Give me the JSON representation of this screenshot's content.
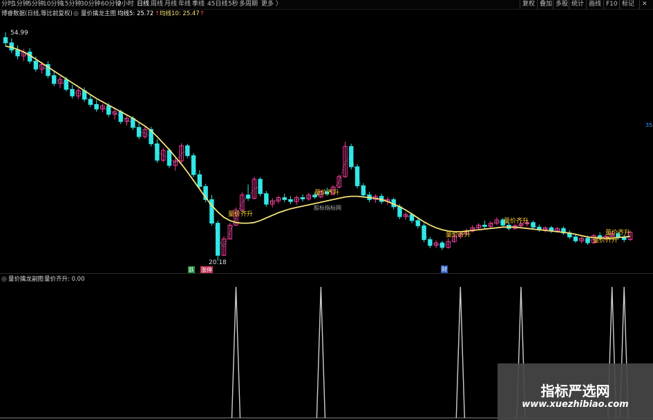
{
  "toolbar": {
    "periods": [
      {
        "label": "分时",
        "active": false
      },
      {
        "label": "1分钟",
        "active": false
      },
      {
        "label": "5分钟",
        "active": false
      },
      {
        "label": "10分钟",
        "active": false
      },
      {
        "label": "15分钟",
        "active": false
      },
      {
        "label": "30分钟",
        "active": false
      },
      {
        "label": "60分钟",
        "active": false
      },
      {
        "label": "2小时",
        "active": false
      },
      {
        "label": "日线",
        "active": true
      },
      {
        "label": "周线",
        "active": false
      },
      {
        "label": "月线",
        "active": false
      },
      {
        "label": "年线",
        "active": false
      },
      {
        "label": "季线",
        "active": false
      },
      {
        "label": "45日线",
        "active": false
      },
      {
        "label": "5秒",
        "active": false
      },
      {
        "label": "多周期",
        "active": false
      },
      {
        "label": "更多 〉",
        "active": false
      }
    ],
    "right_buttons": [
      "复权",
      "叠加",
      "多股",
      "统计",
      "画线",
      "F10",
      "标记"
    ]
  },
  "info_bar": {
    "source": "博睿数据(日线,等比前复权)",
    "indicator": "量价擒龙主图",
    "ma5_label": "均线5: 25.72",
    "ma10_label": "均线10: 25.47"
  },
  "main_chart": {
    "high_label": "54.99",
    "low_label": "20.18",
    "signal_label": "量价齐升",
    "center_watermark": "股标指标网",
    "badge_die": "跌",
    "badge_zhang": "涨停",
    "badge_cai": "财",
    "right_edge_label": "35"
  },
  "sub_chart": {
    "title": "量价擒龙副图",
    "value_label": "量价齐升: 0.00"
  },
  "watermark": {
    "title": "指标严选网",
    "url": "www.xuezhibiao.com"
  },
  "colors": {
    "up": "#ff3aa0",
    "down": "#2ee6e6",
    "ma_line": "#f5e27a",
    "spike": "#cfcfcf",
    "signal_text": "#ffd230"
  },
  "chart_data": {
    "type": "candlestick",
    "ylim": [
      20.18,
      54.99
    ],
    "candles": [
      {
        "o": 54.2,
        "h": 54.99,
        "l": 52.9,
        "c": 53.4
      },
      {
        "o": 53.4,
        "h": 54.1,
        "l": 51.8,
        "c": 52.3
      },
      {
        "o": 52.3,
        "h": 53.0,
        "l": 50.9,
        "c": 51.4
      },
      {
        "o": 51.4,
        "h": 52.5,
        "l": 50.6,
        "c": 52.0
      },
      {
        "o": 52.0,
        "h": 52.6,
        "l": 50.2,
        "c": 50.6
      },
      {
        "o": 50.6,
        "h": 51.3,
        "l": 49.0,
        "c": 49.4
      },
      {
        "o": 49.4,
        "h": 50.5,
        "l": 48.7,
        "c": 50.1
      },
      {
        "o": 50.1,
        "h": 50.6,
        "l": 48.0,
        "c": 48.4
      },
      {
        "o": 48.4,
        "h": 49.1,
        "l": 46.8,
        "c": 47.2
      },
      {
        "o": 47.2,
        "h": 48.3,
        "l": 46.5,
        "c": 47.8
      },
      {
        "o": 47.8,
        "h": 48.2,
        "l": 46.0,
        "c": 46.3
      },
      {
        "o": 46.3,
        "h": 47.0,
        "l": 44.9,
        "c": 45.3
      },
      {
        "o": 45.3,
        "h": 46.5,
        "l": 44.8,
        "c": 46.1
      },
      {
        "o": 46.1,
        "h": 46.6,
        "l": 44.4,
        "c": 44.8
      },
      {
        "o": 44.8,
        "h": 45.5,
        "l": 43.6,
        "c": 44.0
      },
      {
        "o": 44.0,
        "h": 44.7,
        "l": 42.9,
        "c": 43.3
      },
      {
        "o": 43.3,
        "h": 44.1,
        "l": 42.8,
        "c": 43.8
      },
      {
        "o": 43.8,
        "h": 44.2,
        "l": 42.1,
        "c": 42.5
      },
      {
        "o": 42.5,
        "h": 43.3,
        "l": 41.7,
        "c": 42.9
      },
      {
        "o": 42.9,
        "h": 43.2,
        "l": 41.0,
        "c": 41.4
      },
      {
        "o": 41.4,
        "h": 42.3,
        "l": 40.8,
        "c": 41.9
      },
      {
        "o": 41.9,
        "h": 42.2,
        "l": 40.1,
        "c": 40.5
      },
      {
        "o": 40.5,
        "h": 41.2,
        "l": 38.7,
        "c": 39.1
      },
      {
        "o": 39.1,
        "h": 40.6,
        "l": 38.8,
        "c": 40.2
      },
      {
        "o": 40.2,
        "h": 40.6,
        "l": 37.6,
        "c": 38.0
      },
      {
        "o": 38.0,
        "h": 38.7,
        "l": 35.1,
        "c": 35.5
      },
      {
        "o": 35.5,
        "h": 37.4,
        "l": 35.2,
        "c": 37.0
      },
      {
        "o": 37.0,
        "h": 37.3,
        "l": 34.3,
        "c": 34.7
      },
      {
        "o": 34.7,
        "h": 35.8,
        "l": 33.9,
        "c": 35.4
      },
      {
        "o": 35.4,
        "h": 38.1,
        "l": 35.1,
        "c": 37.7
      },
      {
        "o": 37.7,
        "h": 38.0,
        "l": 35.8,
        "c": 36.2
      },
      {
        "o": 36.2,
        "h": 36.6,
        "l": 32.9,
        "c": 33.3
      },
      {
        "o": 33.3,
        "h": 34.0,
        "l": 31.1,
        "c": 31.5
      },
      {
        "o": 31.5,
        "h": 31.9,
        "l": 29.1,
        "c": 29.5
      },
      {
        "o": 29.5,
        "h": 30.2,
        "l": 25.5,
        "c": 25.9
      },
      {
        "o": 25.9,
        "h": 26.3,
        "l": 20.18,
        "c": 21.0
      },
      {
        "o": 21.0,
        "h": 23.9,
        "l": 20.9,
        "c": 23.5
      },
      {
        "o": 23.5,
        "h": 25.9,
        "l": 23.4,
        "c": 25.6
      },
      {
        "o": 25.6,
        "h": 28.3,
        "l": 25.5,
        "c": 27.9
      },
      {
        "o": 27.9,
        "h": 30.6,
        "l": 27.7,
        "c": 30.2
      },
      {
        "o": 30.2,
        "h": 31.8,
        "l": 29.3,
        "c": 29.7
      },
      {
        "o": 29.7,
        "h": 33.0,
        "l": 29.5,
        "c": 32.6
      },
      {
        "o": 32.6,
        "h": 32.9,
        "l": 30.0,
        "c": 30.4
      },
      {
        "o": 30.4,
        "h": 30.8,
        "l": 28.4,
        "c": 28.8
      },
      {
        "o": 28.8,
        "h": 29.7,
        "l": 28.3,
        "c": 29.3
      },
      {
        "o": 29.3,
        "h": 30.1,
        "l": 28.9,
        "c": 29.8
      },
      {
        "o": 29.8,
        "h": 30.4,
        "l": 29.1,
        "c": 29.5
      },
      {
        "o": 29.5,
        "h": 30.0,
        "l": 28.8,
        "c": 29.2
      },
      {
        "o": 29.2,
        "h": 30.1,
        "l": 28.7,
        "c": 29.8
      },
      {
        "o": 29.8,
        "h": 30.3,
        "l": 29.2,
        "c": 29.6
      },
      {
        "o": 29.6,
        "h": 30.5,
        "l": 29.3,
        "c": 30.2
      },
      {
        "o": 30.2,
        "h": 30.6,
        "l": 29.6,
        "c": 29.9
      },
      {
        "o": 29.9,
        "h": 31.0,
        "l": 29.7,
        "c": 30.7
      },
      {
        "o": 30.7,
        "h": 31.3,
        "l": 30.1,
        "c": 30.4
      },
      {
        "o": 30.4,
        "h": 31.7,
        "l": 30.2,
        "c": 31.4
      },
      {
        "o": 31.4,
        "h": 33.3,
        "l": 31.2,
        "c": 33.0
      },
      {
        "o": 33.0,
        "h": 38.3,
        "l": 32.8,
        "c": 37.6
      },
      {
        "o": 37.6,
        "h": 38.0,
        "l": 34.1,
        "c": 34.5
      },
      {
        "o": 34.5,
        "h": 34.9,
        "l": 31.2,
        "c": 31.6
      },
      {
        "o": 31.6,
        "h": 32.0,
        "l": 29.8,
        "c": 30.2
      },
      {
        "o": 30.2,
        "h": 30.7,
        "l": 29.1,
        "c": 29.5
      },
      {
        "o": 29.5,
        "h": 30.3,
        "l": 29.0,
        "c": 30.0
      },
      {
        "o": 30.0,
        "h": 30.4,
        "l": 28.8,
        "c": 29.2
      },
      {
        "o": 29.2,
        "h": 29.9,
        "l": 28.7,
        "c": 29.5
      },
      {
        "o": 29.5,
        "h": 29.8,
        "l": 28.0,
        "c": 28.4
      },
      {
        "o": 28.4,
        "h": 28.8,
        "l": 26.5,
        "c": 26.9
      },
      {
        "o": 26.9,
        "h": 27.6,
        "l": 26.4,
        "c": 27.2
      },
      {
        "o": 27.2,
        "h": 27.5,
        "l": 25.9,
        "c": 26.3
      },
      {
        "o": 26.3,
        "h": 26.7,
        "l": 25.1,
        "c": 25.5
      },
      {
        "o": 25.5,
        "h": 25.9,
        "l": 23.0,
        "c": 23.4
      },
      {
        "o": 23.4,
        "h": 23.8,
        "l": 22.1,
        "c": 22.5
      },
      {
        "o": 22.5,
        "h": 23.3,
        "l": 22.1,
        "c": 22.9
      },
      {
        "o": 22.9,
        "h": 23.2,
        "l": 21.8,
        "c": 22.2
      },
      {
        "o": 22.2,
        "h": 23.6,
        "l": 22.0,
        "c": 23.1
      },
      {
        "o": 23.1,
        "h": 24.3,
        "l": 22.9,
        "c": 23.9
      },
      {
        "o": 23.9,
        "h": 24.6,
        "l": 23.5,
        "c": 24.3
      },
      {
        "o": 24.3,
        "h": 25.1,
        "l": 24.0,
        "c": 24.7
      },
      {
        "o": 24.7,
        "h": 25.6,
        "l": 24.5,
        "c": 25.2
      },
      {
        "o": 25.2,
        "h": 25.9,
        "l": 24.9,
        "c": 25.6
      },
      {
        "o": 25.6,
        "h": 26.3,
        "l": 25.1,
        "c": 25.4
      },
      {
        "o": 25.4,
        "h": 26.2,
        "l": 25.2,
        "c": 25.9
      },
      {
        "o": 25.9,
        "h": 26.8,
        "l": 25.6,
        "c": 26.4
      },
      {
        "o": 26.4,
        "h": 26.7,
        "l": 25.3,
        "c": 25.6
      },
      {
        "o": 25.6,
        "h": 26.0,
        "l": 24.8,
        "c": 25.1
      },
      {
        "o": 25.1,
        "h": 25.8,
        "l": 24.9,
        "c": 25.5
      },
      {
        "o": 25.5,
        "h": 26.1,
        "l": 25.2,
        "c": 25.8
      },
      {
        "o": 25.8,
        "h": 26.4,
        "l": 25.4,
        "c": 26.0
      },
      {
        "o": 26.0,
        "h": 26.3,
        "l": 25.0,
        "c": 25.3
      },
      {
        "o": 25.3,
        "h": 25.7,
        "l": 24.6,
        "c": 24.9
      },
      {
        "o": 24.9,
        "h": 25.4,
        "l": 24.5,
        "c": 25.2
      },
      {
        "o": 25.2,
        "h": 25.5,
        "l": 24.4,
        "c": 24.7
      },
      {
        "o": 24.7,
        "h": 25.3,
        "l": 24.5,
        "c": 25.1
      },
      {
        "o": 25.1,
        "h": 25.4,
        "l": 24.1,
        "c": 24.4
      },
      {
        "o": 24.4,
        "h": 24.8,
        "l": 23.5,
        "c": 23.8
      },
      {
        "o": 23.8,
        "h": 24.2,
        "l": 22.9,
        "c": 23.2
      },
      {
        "o": 23.2,
        "h": 23.9,
        "l": 22.8,
        "c": 23.6
      },
      {
        "o": 23.6,
        "h": 24.0,
        "l": 22.6,
        "c": 22.9
      },
      {
        "o": 22.9,
        "h": 24.3,
        "l": 22.8,
        "c": 24.0
      },
      {
        "o": 24.0,
        "h": 24.5,
        "l": 23.3,
        "c": 23.6
      },
      {
        "o": 23.6,
        "h": 24.2,
        "l": 23.2,
        "c": 23.9
      },
      {
        "o": 23.9,
        "h": 24.6,
        "l": 23.6,
        "c": 24.3
      },
      {
        "o": 24.3,
        "h": 24.6,
        "l": 23.4,
        "c": 23.7
      },
      {
        "o": 23.7,
        "h": 24.1,
        "l": 23.0,
        "c": 23.4
      },
      {
        "o": 23.4,
        "h": 24.8,
        "l": 23.2,
        "c": 24.5
      }
    ],
    "ma_line": [
      52.9,
      52.7,
      52.4,
      52.0,
      51.5,
      50.9,
      50.3,
      49.7,
      49.1,
      48.5,
      47.9,
      47.3,
      46.7,
      46.1,
      45.5,
      44.9,
      44.4,
      43.9,
      43.4,
      42.9,
      42.4,
      41.9,
      41.3,
      40.7,
      40.0,
      39.1,
      38.1,
      37.1,
      36.0,
      34.9,
      33.7,
      32.4,
      31.1,
      29.8,
      28.6,
      27.6,
      26.8,
      26.3,
      26.0,
      25.9,
      25.9,
      26.0,
      26.3,
      26.7,
      27.1,
      27.5,
      27.8,
      28.1,
      28.3,
      28.5,
      28.7,
      28.9,
      29.1,
      29.3,
      29.5,
      29.7,
      29.9,
      30.0,
      30.0,
      29.9,
      29.8,
      29.7,
      29.5,
      29.2,
      28.8,
      28.4,
      27.9,
      27.3,
      26.7,
      26.1,
      25.6,
      25.2,
      24.9,
      24.7,
      24.6,
      24.6,
      24.7,
      24.8,
      24.9,
      25.0,
      25.1,
      25.2,
      25.3,
      25.3,
      25.3,
      25.2,
      25.1,
      25.0,
      24.9,
      24.8,
      24.7,
      24.6,
      24.5,
      24.4,
      24.2,
      24.0,
      23.8,
      23.7,
      23.6,
      23.6,
      23.6,
      23.7,
      23.8,
      23.9
    ],
    "sub_spikes": [
      {
        "candle": 38,
        "value": 1
      },
      {
        "candle": 52,
        "value": 1
      },
      {
        "candle": 75,
        "value": 1
      },
      {
        "candle": 85,
        "value": 1
      },
      {
        "candle": 100,
        "value": 1
      },
      {
        "candle": 102,
        "value": 1
      }
    ],
    "sub_ylim": [
      0,
      1
    ]
  }
}
